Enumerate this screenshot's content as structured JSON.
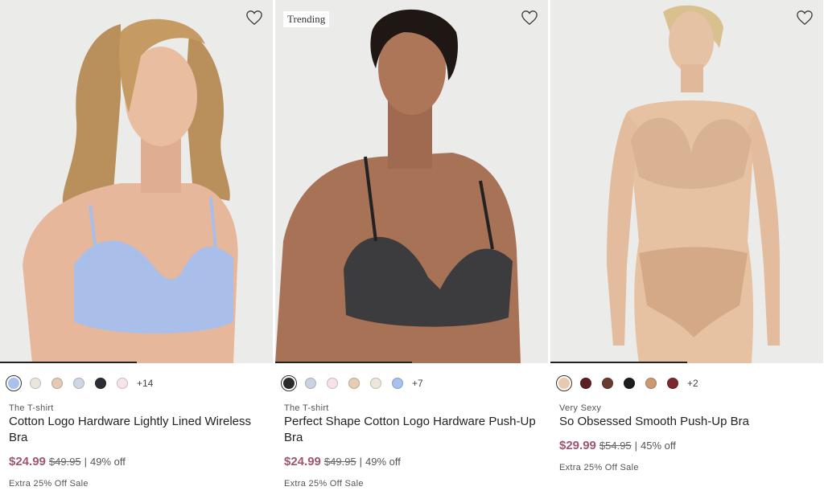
{
  "colors": {
    "accent": "#a05572",
    "photo_bg": "#ececeb"
  },
  "products": [
    {
      "badge": "",
      "collection": "The T-shirt",
      "name": "Cotton Logo Hardware Lightly Lined Wireless Bra",
      "price": "$24.99",
      "original_price": "$49.95",
      "separator": "|",
      "discount": "49% off",
      "promo": "Extra 25% Off Sale",
      "more_colors": "+14",
      "swatches": [
        "#a9c0ec",
        "#ebe6dd",
        "#e4c9b3",
        "#cfd7e3",
        "#2a2d33",
        "#f6e4ea"
      ],
      "selected_swatch": 0,
      "garment_color": "#a9bfea"
    },
    {
      "badge": "Trending",
      "collection": "The T-shirt",
      "name": "Perfect Shape Cotton Logo Hardware Push-Up Bra",
      "price": "$24.99",
      "original_price": "$49.95",
      "separator": "|",
      "discount": "49% off",
      "promo": "Extra 25% Off Sale",
      "more_colors": "+7",
      "swatches": [
        "#2c2c2e",
        "#cbd3e2",
        "#f6e3ea",
        "#e8ccb4",
        "#ece6dc",
        "#a8c2ef"
      ],
      "selected_swatch": 0,
      "garment_color": "#3c3c3e"
    },
    {
      "badge": "",
      "collection": "Very Sexy",
      "name": "So Obsessed Smooth Push-Up Bra",
      "price": "$29.99",
      "original_price": "$54.95",
      "separator": "|",
      "discount": "45% off",
      "promo": "Extra 25% Off Sale",
      "more_colors": "+2",
      "swatches": [
        "#e9c9ae",
        "#5b1f24",
        "#6b3a2e",
        "#1e1e20",
        "#c99a73",
        "#7a2a2e"
      ],
      "selected_swatch": 0,
      "garment_color": "#d9b293"
    }
  ]
}
